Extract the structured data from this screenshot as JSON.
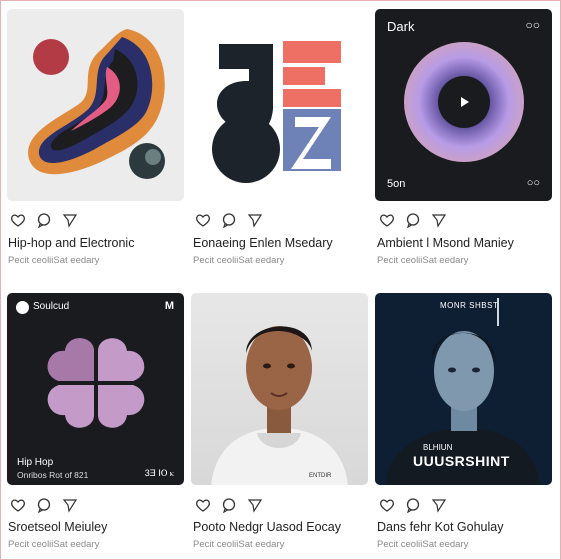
{
  "cards": [
    {
      "title": "Hip-hop and Electronic",
      "meta": "Pecit ceoliiSat eedary"
    },
    {
      "title": "Eonaeing Enlen Msedary",
      "meta": "Pecit ceoliiSat eedary"
    },
    {
      "title": "Ambient l Msond Maniey",
      "meta": "Pecit ceoliiSat eedary",
      "art": {
        "top_label": "Dark",
        "top_right": "○○",
        "bottom_left": "5on",
        "bottom_right": "○○"
      }
    },
    {
      "title": "Sroetseol Meiuley",
      "meta": "Pecit ceoliiSat eedary",
      "art": {
        "brand": "Soulcud",
        "line1": "Hip Hop",
        "line2": "Onribos Rot of 821",
        "controls": "3Ǝ ⅠⲞ ⲕ"
      }
    },
    {
      "title": "Pooto Nedgr Uasod Eocay",
      "meta": "Pecit ceoliiSat eedary",
      "art": {
        "shirt_text": "ENTDIR"
      }
    },
    {
      "title": "Dans fehr Kot Gohulay",
      "meta": "Pecit ceoliiSat eedary",
      "art": {
        "top": "MONR SHBST",
        "sub": "BLHIUN",
        "headline": "UUUSRSHINT"
      }
    }
  ],
  "icons": [
    "heart-icon",
    "comment-icon",
    "share-icon"
  ],
  "colors": {
    "accent_purple": "#9b7fd6",
    "coral": "#ee6f63",
    "slate": "#6f82b7",
    "navy": "#0f1f33",
    "dark": "#1a1b1f"
  }
}
